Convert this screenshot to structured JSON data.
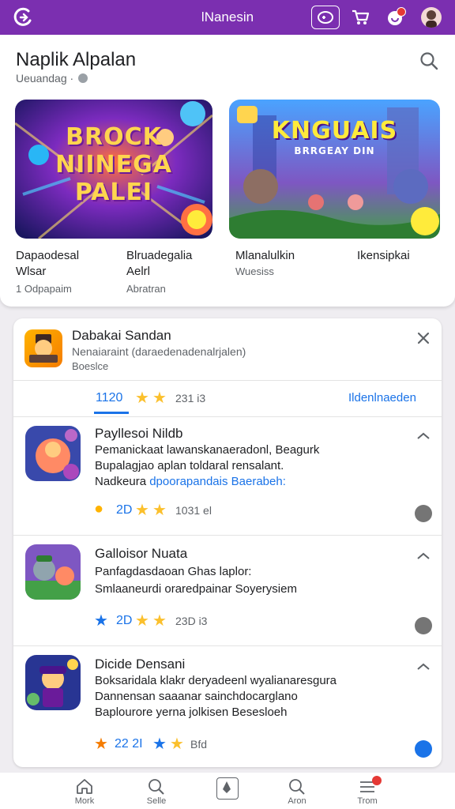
{
  "topbar": {
    "title": "lNanesin",
    "bg_color": "#7b2fb0",
    "icons": [
      "app-logo-icon",
      "controller-icon",
      "cart-icon",
      "notification-icon",
      "profile-avatar"
    ]
  },
  "featured": {
    "title": "Naplik Alpalan",
    "subtitle": "Ueuandag ·",
    "games": [
      {
        "art_title": "BROCK NIINEGA PALEI",
        "name_lines": [
          "Dapaodesal",
          "Wlsar"
        ],
        "meta": "1 Odpapaim"
      },
      {
        "art_title": "Blruadegalia",
        "name_lines": [
          "Blruadegalia",
          "Aelrl"
        ],
        "meta": "Abratran"
      },
      {
        "art_title": "KNGUAIS",
        "art_subtitle": "BRRGEAY DIN",
        "name_lines": [
          "Mlanalulkin"
        ],
        "meta": "Wuesiss"
      },
      {
        "art_title": "",
        "name_lines": [
          "Ikensipkai"
        ],
        "meta": ""
      }
    ]
  },
  "detail": {
    "title": "Dabakai Sandan",
    "subtitle": "Nenaiaraint (daraedenadenalrjalen)",
    "subtitle2": "Boeslce",
    "tab_rating": "1120",
    "tab_count": "231 i3",
    "tab_link": "Ildenlnaeden",
    "items": [
      {
        "title": "Payllesoi Nildb",
        "line1": "Pemanickaat lawanskanaeradonl, Beagurk",
        "line2": "Bupalagjao aplan toldaral rensalant.",
        "line3_prefix": "Nadkeura ",
        "line3_link": "dpoorapandais Baerabeh:",
        "rating": "2D",
        "count": "1031 el"
      },
      {
        "title": "Galloisor Nuata",
        "line1": "Panfagdasdaoan Ghas laplor:",
        "line2": "Smlaaneurdi oraredpainar Soyerysiem",
        "rating": "2D",
        "count": "23D i3"
      },
      {
        "title": "Dicide Densani",
        "line1": "Boksaridala klakr deryadeenl wyalianaresgura",
        "line2": "Dannensan saaanar sainchdocarglano",
        "line3": "Baplourore yerna jolkisen Besesloeh",
        "rating": "22 2I",
        "count": "Bfd"
      }
    ]
  },
  "bottomnav": {
    "items": [
      {
        "label": "Mork",
        "icon": "home-icon"
      },
      {
        "label": "Selle",
        "icon": "search-icon"
      },
      {
        "label": "",
        "icon": "store-center-icon"
      },
      {
        "label": "Aron",
        "icon": "search-alt-icon"
      },
      {
        "label": "Trom",
        "icon": "menu-icon"
      }
    ]
  }
}
